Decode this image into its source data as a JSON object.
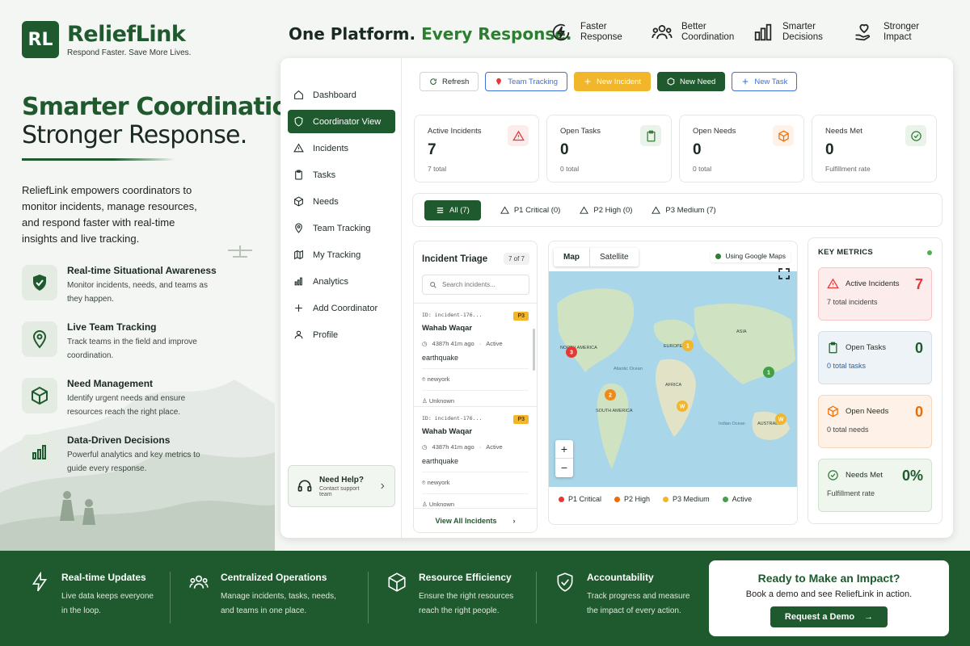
{
  "brand": {
    "logo": "RL",
    "name": "ReliefLink",
    "tagline": "Respond Faster. Save More Lives."
  },
  "headline": {
    "part1": "One Platform.",
    "part2": "Every Response."
  },
  "top_features": [
    {
      "icon": "lightning-circle-icon",
      "line1": "Faster",
      "line2": "Response"
    },
    {
      "icon": "team-icon",
      "line1": "Better",
      "line2": "Coordination"
    },
    {
      "icon": "bar-chart-icon",
      "line1": "Smarter",
      "line2": "Decisions"
    },
    {
      "icon": "heart-hand-icon",
      "line1": "Stronger",
      "line2": "Impact"
    }
  ],
  "hero": {
    "title_line1": "Smarter Coordination.",
    "title_line2": "Stronger Response.",
    "description": "ReliefLink empowers coordinators to monitor incidents, manage resources, and respond faster with real-time insights and live tracking."
  },
  "features": [
    {
      "icon": "shield-check-icon",
      "title": "Real-time Situational Awareness",
      "desc": "Monitor incidents, needs, and teams as they happen."
    },
    {
      "icon": "location-pin-icon",
      "title": "Live Team Tracking",
      "desc": "Track teams in the field and improve coordination."
    },
    {
      "icon": "box-icon",
      "title": "Need Management",
      "desc": "Identify urgent needs and ensure resources reach the right place."
    },
    {
      "icon": "bar-chart-icon",
      "title": "Data-Driven Decisions",
      "desc": "Powerful analytics and key metrics to guide every response."
    }
  ],
  "nav": {
    "items": [
      {
        "icon": "home-icon",
        "label": "Dashboard"
      },
      {
        "icon": "shield-icon",
        "label": "Coordinator View"
      },
      {
        "icon": "warning-icon",
        "label": "Incidents"
      },
      {
        "icon": "clipboard-icon",
        "label": "Tasks"
      },
      {
        "icon": "box-icon",
        "label": "Needs"
      },
      {
        "icon": "location-pin-icon",
        "label": "Team Tracking"
      },
      {
        "icon": "map-icon",
        "label": "My Tracking"
      },
      {
        "icon": "bar-chart-icon",
        "label": "Analytics"
      },
      {
        "icon": "plus-icon",
        "label": "Add Coordinator"
      },
      {
        "icon": "user-icon",
        "label": "Profile"
      }
    ],
    "help_title": "Need Help?",
    "help_sub": "Contact support team"
  },
  "toolbar": {
    "refresh": "Refresh",
    "team_tracking": "Team Tracking",
    "new_incident": "New Incident",
    "new_need": "New Need",
    "new_task": "New Task"
  },
  "stats": [
    {
      "label": "Active Incidents",
      "value": "7",
      "sub": "7 total",
      "icon": "warning-icon",
      "color": "#e53935"
    },
    {
      "label": "Open Tasks",
      "value": "0",
      "sub": "0 total",
      "icon": "clipboard-icon",
      "color": "#2e7d32"
    },
    {
      "label": "Open Needs",
      "value": "0",
      "sub": "0 total",
      "icon": "box-icon",
      "color": "#ef6c00"
    },
    {
      "label": "Needs Met",
      "value": "0",
      "sub": "Fulfillment rate",
      "icon": "check-circle-icon",
      "color": "#2e7d32"
    }
  ],
  "filters": [
    {
      "label": "All (7)",
      "icon": "list-icon"
    },
    {
      "label": "P1 Critical (0)",
      "icon": "warning-icon"
    },
    {
      "label": "P2 High (0)",
      "icon": "warning-icon"
    },
    {
      "label": "P3 Medium (7)",
      "icon": "warning-icon"
    }
  ],
  "triage": {
    "title": "Incident Triage",
    "count": "7 of 7",
    "search_placeholder": "Search incidents...",
    "incidents": [
      {
        "id": "ID: incident-176...",
        "priority": "P3",
        "name": "Wahab Waqar",
        "time": "4387h 41m ago",
        "status": "Active",
        "type": "earthquake",
        "location": "newyork",
        "assignee": "Unknown"
      },
      {
        "id": "ID: incident-176...",
        "priority": "P3",
        "name": "Wahab Waqar",
        "time": "4387h 41m ago",
        "status": "Active",
        "type": "earthquake",
        "location": "newyork",
        "assignee": "Unknown"
      }
    ],
    "view_all": "View All Incidents"
  },
  "map": {
    "tab_map": "Map",
    "tab_satellite": "Satellite",
    "provider": "Using Google Maps",
    "labels": {
      "na": "NORTH AMERICA",
      "europe": "EUROPE",
      "asia": "ASIA",
      "africa": "AFRICA",
      "sa": "SOUTH AMERICA",
      "australia": "AUSTRALIA",
      "atlantic": "Atlantic Ocean",
      "indian": "Indian Ocean"
    },
    "markers": [
      {
        "label": "3",
        "kind": "critical"
      },
      {
        "label": "1",
        "kind": "medium"
      },
      {
        "label": "1",
        "kind": "active"
      },
      {
        "label": "2",
        "kind": "high"
      },
      {
        "label": "W",
        "kind": "medium"
      },
      {
        "label": "W",
        "kind": "medium"
      }
    ],
    "zoom_in": "+",
    "zoom_out": "−",
    "legend": [
      {
        "label": "P1 Critical",
        "color": "#e53935"
      },
      {
        "label": "P2 High",
        "color": "#ef6c00"
      },
      {
        "label": "P3 Medium",
        "color": "#f1b62c"
      },
      {
        "label": "Active",
        "color": "#43a047"
      }
    ]
  },
  "metrics": {
    "title": "KEY METRICS",
    "items": [
      {
        "label": "Active Incidents",
        "value": "7",
        "sub": "7 total incidents",
        "icon": "warning-icon",
        "color": "#e53935"
      },
      {
        "label": "Open Tasks",
        "value": "0",
        "sub": "0 total tasks",
        "icon": "clipboard-icon",
        "color": "#1f5a2e"
      },
      {
        "label": "Open Needs",
        "value": "0",
        "sub": "0 total needs",
        "icon": "box-icon",
        "color": "#ef6c00"
      },
      {
        "label": "Needs Met",
        "value": "0%",
        "sub": "Fulfillment rate",
        "icon": "check-circle-icon",
        "color": "#1f5a2e"
      }
    ]
  },
  "footer": {
    "features": [
      {
        "icon": "lightning-icon",
        "title": "Real-time Updates",
        "line1": "Live data keeps everyone",
        "line2": "in the loop."
      },
      {
        "icon": "team-icon",
        "title": "Centralized Operations",
        "line1": "Manage incidents, tasks, needs,",
        "line2": "and teams in one place."
      },
      {
        "icon": "box-icon",
        "title": "Resource Efficiency",
        "line1": "Ensure the right resources",
        "line2": "reach the right people."
      },
      {
        "icon": "shield-check-icon",
        "title": "Accountability",
        "line1": "Track progress and measure",
        "line2": "the impact of every action."
      }
    ],
    "cta_title": "Ready to Make an Impact?",
    "cta_sub": "Book a demo and see ReliefLink in action.",
    "cta_button": "Request a Demo"
  },
  "colors": {
    "brand": "#1f5a2e",
    "accent_yellow": "#f1b62c",
    "blue": "#3f6fd8",
    "red": "#e53935",
    "orange": "#ef6c00"
  }
}
